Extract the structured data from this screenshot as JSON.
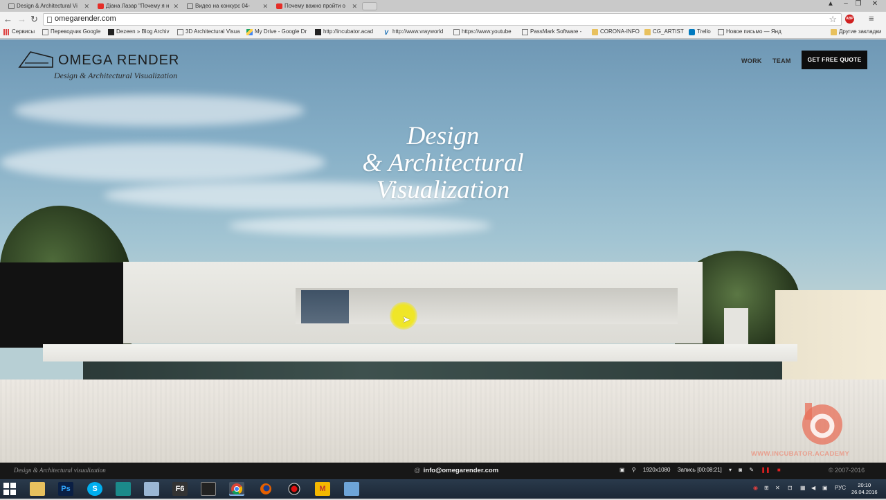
{
  "browser": {
    "tabs": [
      {
        "title": "Design & Architectural Vi",
        "icon": "page-icon",
        "active": true
      },
      {
        "title": "Діана Лазар \"Почему я н",
        "icon": "youtube-icon",
        "active": false
      },
      {
        "title": "Видео на конкурс 04-",
        "icon": "document-icon",
        "active": false
      },
      {
        "title": "Почему важно пройти о",
        "icon": "youtube-icon",
        "active": false
      }
    ],
    "url": "omegarender.com",
    "adblock_label": "ABP",
    "bookmarks": [
      {
        "label": "Сервисы",
        "icon": "apps-icon"
      },
      {
        "label": "Переводчик Google",
        "icon": "page-icon"
      },
      {
        "label": "Dezeen » Blog Archiv",
        "icon": "dezeen-icon"
      },
      {
        "label": "3D Architectural Visua",
        "icon": "shield-icon"
      },
      {
        "label": "My Drive - Google Dr",
        "icon": "drive-icon"
      },
      {
        "label": "http://incubator.acad",
        "icon": "incubator-icon"
      },
      {
        "label": "http://www.vrayworld",
        "icon": "vray-icon"
      },
      {
        "label": "https://www.youtube",
        "icon": "page-icon"
      },
      {
        "label": "PassMark Software - ",
        "icon": "passmark-icon"
      },
      {
        "label": "CORONA-INFO",
        "icon": "folder-icon"
      },
      {
        "label": "CG_ARTIST",
        "icon": "folder-icon"
      },
      {
        "label": "Trello",
        "icon": "trello-icon"
      },
      {
        "label": "Новое письмо — Янд",
        "icon": "mail-icon"
      }
    ],
    "other_bookmarks": "Другие закладки"
  },
  "site": {
    "logo_name": "OMEGA RENDER",
    "logo_tagline": "Design & Architectural Visualization",
    "nav": {
      "work": "WORK",
      "team": "TEAM"
    },
    "cta": "GET FREE QUOTE",
    "hero": {
      "line1": "Design",
      "line2": "& Architectural",
      "line3": "Visualization"
    },
    "footer": {
      "tagline": "Design & Architectural visualization",
      "email": "info@omegarender.com",
      "copyright": "© 2007-2016"
    },
    "watermark_text": "WWW.INCUBATOR.ACADEMY",
    "colors": {
      "cta_bg": "#0d0d0d",
      "watermark": "#e8705a",
      "sky": "#86afc7"
    }
  },
  "recorder": {
    "resolution": "1920x1080",
    "recording": "Запись [00:08:21]"
  },
  "taskbar": {
    "apps": [
      "explorer-icon",
      "photoshop-icon",
      "skype-icon",
      "3ds-icon",
      "notepad-icon",
      "f6-icon",
      "video-icon",
      "chrome-icon",
      "firefox-icon",
      "record-icon",
      "m-icon",
      "window-icon"
    ],
    "photoshop_label": "Ps",
    "f6_label": "F6",
    "m_label": "M",
    "lang": "РУС",
    "time": "20:10",
    "date": "26.04.2016"
  }
}
